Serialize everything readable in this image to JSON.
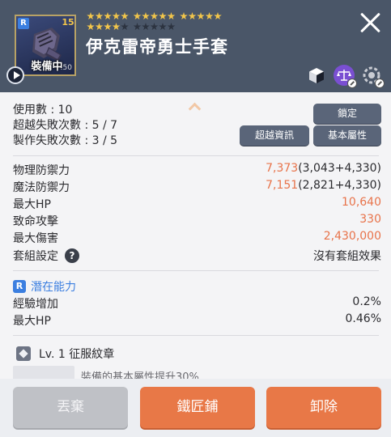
{
  "header": {
    "item_name": "伊克雷帝勇士手套",
    "rank_badge": "R",
    "level_badge": "15",
    "equip_label": "裝備中",
    "equip_count": ".50",
    "stars_filled": 19,
    "stars_total": 25
  },
  "usage": {
    "use_count": "使用數 : 10",
    "overtrans_fail": "超越失敗次數 : 5 / 7",
    "craft_fail": "製作失敗次數 : 3 / 5"
  },
  "buttons": {
    "lock": "鎖定",
    "overtrans_info": "超越資訊",
    "base_attr": "基本屬性"
  },
  "stats": [
    {
      "label": "物理防禦力",
      "value_orange": "7,373",
      "value_rest": "(3,043+4,330)"
    },
    {
      "label": "魔法防禦力",
      "value_orange": "7,151",
      "value_rest": "(2,821+4,330)"
    },
    {
      "label": "最大HP",
      "value_orange": "10,640",
      "value_rest": ""
    },
    {
      "label": "致命攻擊",
      "value_orange": "330",
      "value_rest": ""
    },
    {
      "label": "最大傷害",
      "value_orange": "2,430,000",
      "value_rest": ""
    }
  ],
  "set_info": {
    "label": "套組設定",
    "help": "?",
    "value": "沒有套組效果"
  },
  "potential": {
    "badge": "R",
    "title": "潛在能力",
    "rows": [
      {
        "label": "經驗增加",
        "value": "0.2%"
      },
      {
        "label": "最大HP",
        "value": "0.46%"
      }
    ]
  },
  "emblem": {
    "label": "Lv. 1 征服紋章",
    "desc": "裝備的基本屬性提升30%"
  },
  "footer": {
    "discard": "丟棄",
    "blacksmith": "鐵匠鋪",
    "unequip": "卸除"
  },
  "colors": {
    "header_bg": "#4a5668",
    "accent_orange": "#e8734a",
    "potential_blue": "#3c7fe0",
    "star_gold": "#f3c64a"
  }
}
